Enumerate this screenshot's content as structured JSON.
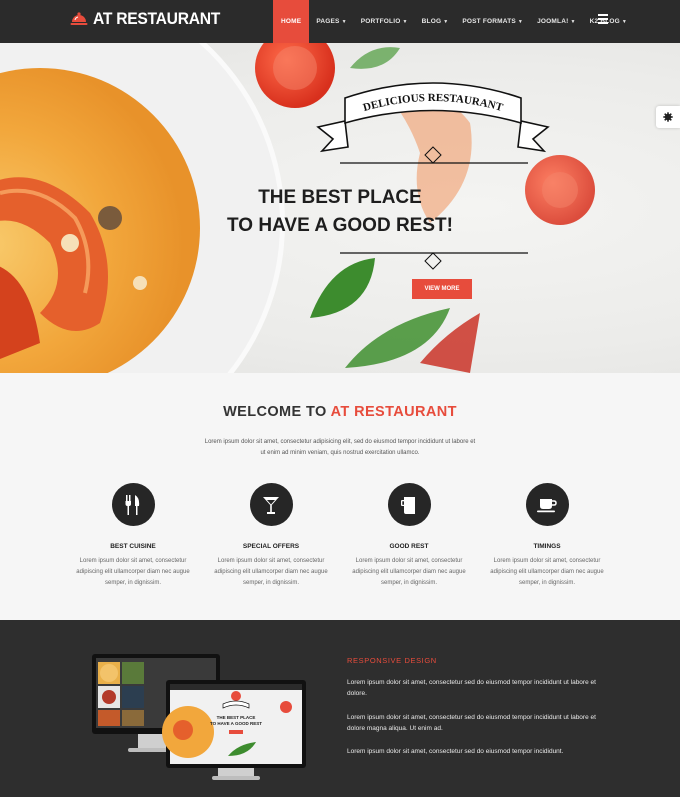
{
  "header": {
    "logo_text": "AT RESTAURANT",
    "nav": [
      {
        "label": "HOME",
        "active": true,
        "caret": false
      },
      {
        "label": "PAGES",
        "caret": true
      },
      {
        "label": "PORTFOLIO",
        "caret": true
      },
      {
        "label": "BLOG",
        "caret": true
      },
      {
        "label": "POST FORMATS",
        "caret": true
      },
      {
        "label": "JOOMLA!",
        "caret": true
      },
      {
        "label": "K2 BLOG",
        "caret": true
      }
    ]
  },
  "hero": {
    "ribbon_text": "DELICIOUS RESTAURANT",
    "headline_line1": "THE BEST PLACE",
    "headline_line2": "TO HAVE A GOOD REST!",
    "button_label": "VIEW MORE"
  },
  "welcome": {
    "title_prefix": "WELCOME TO ",
    "title_accent": "AT RESTAURANT",
    "intro_line1": "Lorem ipsum dolor sit amet, consectetur adipisicing elit, sed do eiusmod tempor incididunt ut labore et",
    "intro_line2": "ut enim ad minim veniam, quis nostrud exercitation ullamco.",
    "features": [
      {
        "icon": "cutlery-icon",
        "title": "BEST CUISINE",
        "line1": "Lorem ipsum dolor sit amet, consectetur",
        "line2": "adipiscing elit ullamcorper diam nec augue",
        "line3": "semper, in dignissim."
      },
      {
        "icon": "cocktail-icon",
        "title": "SPECIAL OFFERS",
        "line1": "Lorem ipsum dolor sit amet, consectetur",
        "line2": "adipiscing elit ullamcorper diam nec augue",
        "line3": "semper, in dignissim."
      },
      {
        "icon": "beer-mug-icon",
        "title": "GOOD REST",
        "line1": "Lorem ipsum dolor sit amet, consectetur",
        "line2": "adipiscing elit ullamcorper diam nec augue",
        "line3": "semper, in dignissim."
      },
      {
        "icon": "coffee-cup-icon",
        "title": "TIMINGS",
        "line1": "Lorem ipsum dolor sit amet, consectetur",
        "line2": "adipiscing elit ullamcorper diam nec augue",
        "line3": "semper, in dignissim."
      }
    ]
  },
  "responsive": {
    "title": "RESPONSIVE DESIGN",
    "p1_line1": "Lorem ipsum dolor sit amet, consectetur sed do eiusmod tempor incididunt ut labore et",
    "p1_line2": "dolore.",
    "p2_line1": "Lorem ipsum dolor sit amet, consectetur sed do eiusmod tempor incididunt ut labore et",
    "p2_line2": "dolore magna aliqua. Ut enim ad.",
    "p3": "Lorem ipsum dolor sit amet, consectetur sed do eiusmod tempor incididunt.",
    "mockup_line1": "THE BEST PLACE",
    "mockup_line2": "TO HAVE A GOOD REST"
  },
  "colors": {
    "accent": "#e74c3c",
    "header_bg": "#2b2b2b",
    "dark_bg": "#2e2e2e",
    "light_bg": "#f6f6f6"
  }
}
